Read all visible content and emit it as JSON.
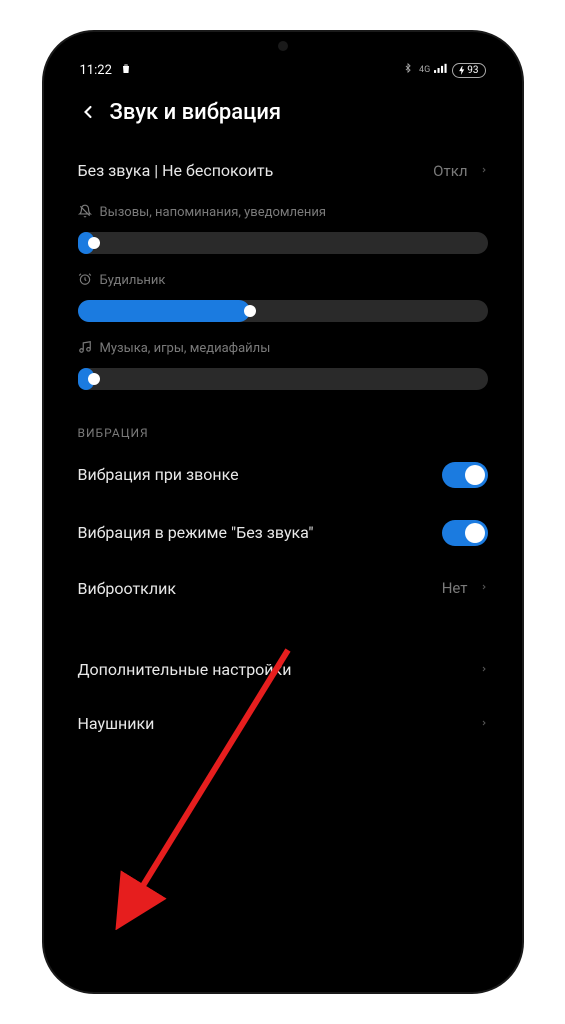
{
  "status": {
    "time": "11:22",
    "battery": "93"
  },
  "header": {
    "title": "Звук и вибрация"
  },
  "dnd": {
    "label": "Без звука | Не беспокоить",
    "value": "Откл"
  },
  "sliders": {
    "ring": {
      "label": "Вызовы, напоминания, уведомления",
      "percent": 4
    },
    "alarm": {
      "label": "Будильник",
      "percent": 42
    },
    "media": {
      "label": "Музыка, игры, медиафайлы",
      "percent": 4
    }
  },
  "vibration": {
    "section": "ВИБРАЦИЯ",
    "onCall": "Вибрация при звонке",
    "silent": "Вибрация в режиме \"Без звука\"",
    "haptic": {
      "label": "Виброотклик",
      "value": "Нет"
    }
  },
  "more": {
    "advanced": "Дополнительные настройки",
    "headphones": "Наушники"
  }
}
